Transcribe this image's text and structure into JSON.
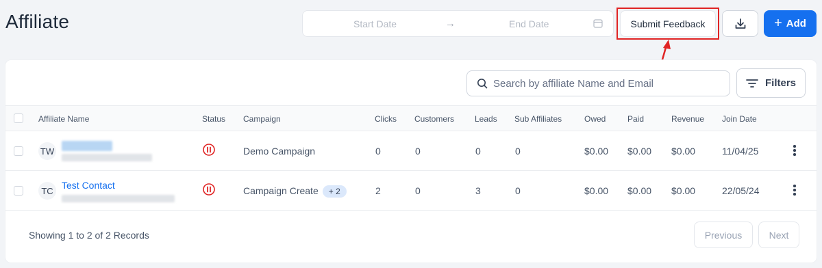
{
  "header": {
    "title": "Affiliate",
    "date_range": {
      "start_placeholder": "Start Date",
      "arrow": "→",
      "end_placeholder": "End Date"
    },
    "submit_feedback_label": "Submit Feedback",
    "add_label": "Add",
    "add_icon": "+"
  },
  "toolbar": {
    "search_placeholder": "Search by affiliate Name and Email",
    "filters_label": "Filters"
  },
  "table": {
    "columns": [
      "Affiliate Name",
      "Status",
      "Campaign",
      "Clicks",
      "Customers",
      "Leads",
      "Sub Affiliates",
      "Owed",
      "Paid",
      "Revenue",
      "Join Date"
    ],
    "rows": [
      {
        "initials": "TW",
        "name": "",
        "campaign": "Demo Campaign",
        "campaign_extra": "",
        "clicks": "0",
        "customers": "0",
        "leads": "0",
        "sub_affiliates": "0",
        "owed": "$0.00",
        "paid": "$0.00",
        "revenue": "$0.00",
        "join_date": "11/04/25"
      },
      {
        "initials": "TC",
        "name": "Test Contact",
        "campaign": "Campaign Create",
        "campaign_extra": "+ 2",
        "clicks": "2",
        "customers": "0",
        "leads": "3",
        "sub_affiliates": "0",
        "owed": "$0.00",
        "paid": "$0.00",
        "revenue": "$0.00",
        "join_date": "22/05/24"
      }
    ]
  },
  "footer": {
    "summary": "Showing 1 to 2 of 2 Records",
    "previous_label": "Previous",
    "next_label": "Next"
  },
  "colors": {
    "primary": "#1570ef",
    "status_paused": "#e02424",
    "highlight": "#e02424"
  }
}
